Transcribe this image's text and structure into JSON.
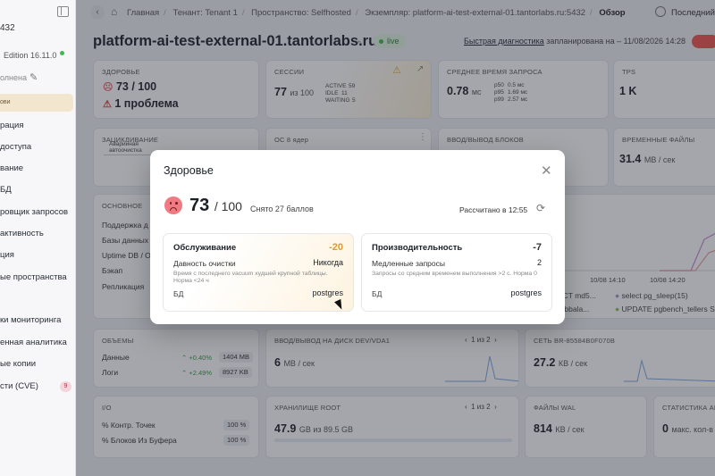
{
  "sidebar": {
    "top_text": "432",
    "edition": "Edition 16.11.0",
    "status": "олнена",
    "active_item": "ови",
    "items": [
      "рация",
      "доступа",
      "вание",
      "БД",
      "ровщик запросов",
      "активность",
      "ция",
      "ые пространства",
      "ки мониторинга",
      "енная аналитика",
      "ые копии",
      "сти (CVE)"
    ],
    "badge": "9"
  },
  "breadcrumbs": {
    "items": [
      "Главная",
      "Тенант: Tenant 1",
      "Пространство: Selfhosted",
      "Экземпляр: platform-ai-test-external-01.tantorlabs.ru:5432"
    ],
    "current": "Обзор"
  },
  "time_range": "Последний ч",
  "header": {
    "title": "platform-ai-test-external-01.tantorlabs.ru",
    "live": "live",
    "diag_link": "Быстрая диагностика",
    "diag_text": "запланирована на – 11/08/2026 14:28"
  },
  "cards": {
    "health": {
      "title": "ЗДОРОВЬЕ",
      "score": "73 / 100",
      "problems": "1 проблема"
    },
    "sessions": {
      "title": "СЕССИИ",
      "value": "77",
      "of": "из 100",
      "rows": [
        [
          "ACTIVE",
          "59"
        ],
        [
          "IDLE",
          "11"
        ],
        [
          "WAITING",
          "5"
        ]
      ]
    },
    "avg_query": {
      "title": "СРЕДНЕЕ ВРЕМЯ ЗАПРОСА",
      "value": "0.78",
      "unit": "мс",
      "rows": [
        [
          "p50",
          "0.5 мс"
        ],
        [
          "p95",
          "1.69 мс"
        ],
        [
          "p99",
          "2.57 мс"
        ]
      ]
    },
    "tps": {
      "title": "TPS",
      "value": "1 K"
    },
    "wraparound": {
      "title": "ЗАЦИКЛИВАНИЕ",
      "note": "Аварийная автоочистка"
    },
    "os": {
      "title": "ОС 8 ядер"
    },
    "block_io": {
      "title": "ВВОД/ВЫВОД БЛОКОВ"
    },
    "temp_files": {
      "title": "ВРЕМЕННЫЕ ФАЙЛЫ",
      "value": "31.4",
      "unit": "МВ / сек"
    },
    "basic": {
      "title": "ОСНОВНОЕ",
      "rows": [
        "Поддержка д",
        "Базы данных",
        "Uptime DB / O",
        "Бэкап",
        "Репликация"
      ]
    },
    "queries": {
      "axis": [
        "10/08 14:10",
        "10/08 14:20"
      ],
      "legend": [
        "ECT md5...",
        "select pg_sleep(15)",
        "T bbala...",
        "UPDATE pgbench_tellers S"
      ]
    },
    "volumes": {
      "title": "ОБЪЕМЫ",
      "rows": [
        {
          "label": "Данные",
          "pct": "+0.40%",
          "value": "1404 MB"
        },
        {
          "label": "Логи",
          "pct": "+2.49%",
          "value": "8927 KB"
        }
      ]
    },
    "disk_io": {
      "title": "ВВОД/ВЫВОД НА ДИСК DEV/VDA1",
      "pager": "1 из 2",
      "value": "6",
      "unit": "МВ / сек"
    },
    "network": {
      "title": "СЕТЬ BR-85584B0F070B",
      "value": "27.2",
      "unit": "КВ / сек"
    },
    "io": {
      "title": "I/O",
      "rows": [
        {
          "label": "% Контр. Точек",
          "value": "100 %"
        },
        {
          "label": "% Блоков Из Буфера",
          "value": "100 %"
        }
      ]
    },
    "storage": {
      "title": "ХРАНИЛИЩЕ ROOT",
      "pager": "1 из 2",
      "value": "47.9",
      "unit": "GB из 89.5 GB"
    },
    "wal": {
      "title": "ФАЙЛЫ WAL",
      "value": "814",
      "unit": "КВ / сек"
    },
    "autovac": {
      "title": "СТАТИСТИКА АВТ",
      "value": "0",
      "unit": "макс. кол-в"
    }
  },
  "modal": {
    "title": "Здоровье",
    "score": "73",
    "max": "/ 100",
    "deduction": "Снято 27 баллов",
    "calculated": "Рассчитано в 12:55",
    "panels": [
      {
        "title": "Обслуживание",
        "score": "-20",
        "label": "Давность очистки",
        "value": "Никогда",
        "desc": "Время с последнего vacuum худшей крупной таблицы. Норма <24 ч",
        "db_label": "БД",
        "db": "postgres"
      },
      {
        "title": "Производительность",
        "score": "-7",
        "label": "Медленные запросы",
        "value": "2",
        "desc": "Запросы со средним временем выполнения >2 с. Норма 0",
        "db_label": "БД",
        "db": "postgres"
      }
    ]
  },
  "colors": {
    "overlay": "#282c37",
    "accent_orange": "#e19a2a",
    "live_green": "#3fb950",
    "alert_red": "#ef5350"
  }
}
